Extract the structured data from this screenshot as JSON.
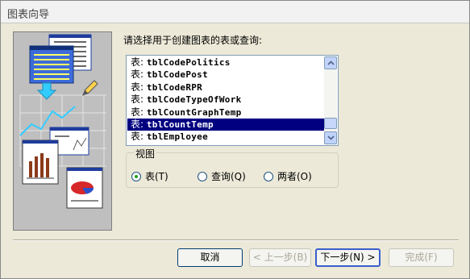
{
  "window": {
    "title": "图表向导"
  },
  "prompt": "请选择用于创建图表的表或查询:",
  "list": {
    "items": [
      {
        "prefix": "表:",
        "name": "tblCodePolitics",
        "selected": false
      },
      {
        "prefix": "表:",
        "name": "tblCodePost",
        "selected": false
      },
      {
        "prefix": "表:",
        "name": "tblCodeRPR",
        "selected": false
      },
      {
        "prefix": "表:",
        "name": "tblCodeTypeOfWork",
        "selected": false
      },
      {
        "prefix": "表:",
        "name": "tblCountGraphTemp",
        "selected": false
      },
      {
        "prefix": "表:",
        "name": "tblCountTemp",
        "selected": true
      },
      {
        "prefix": "表:",
        "name": "tblEmployee",
        "selected": false
      }
    ]
  },
  "view_group": {
    "legend": "视图",
    "options": [
      {
        "label": "表(T)",
        "checked": true
      },
      {
        "label": "查询(Q)",
        "checked": false
      },
      {
        "label": "两者(O)",
        "checked": false
      }
    ]
  },
  "buttons": {
    "cancel": "取消",
    "back": "< 上一步(B)",
    "next": "下一步(N) >",
    "finish": "完成(F)"
  },
  "colors": {
    "selection": "#000080",
    "radio_dot": "#21a121"
  }
}
